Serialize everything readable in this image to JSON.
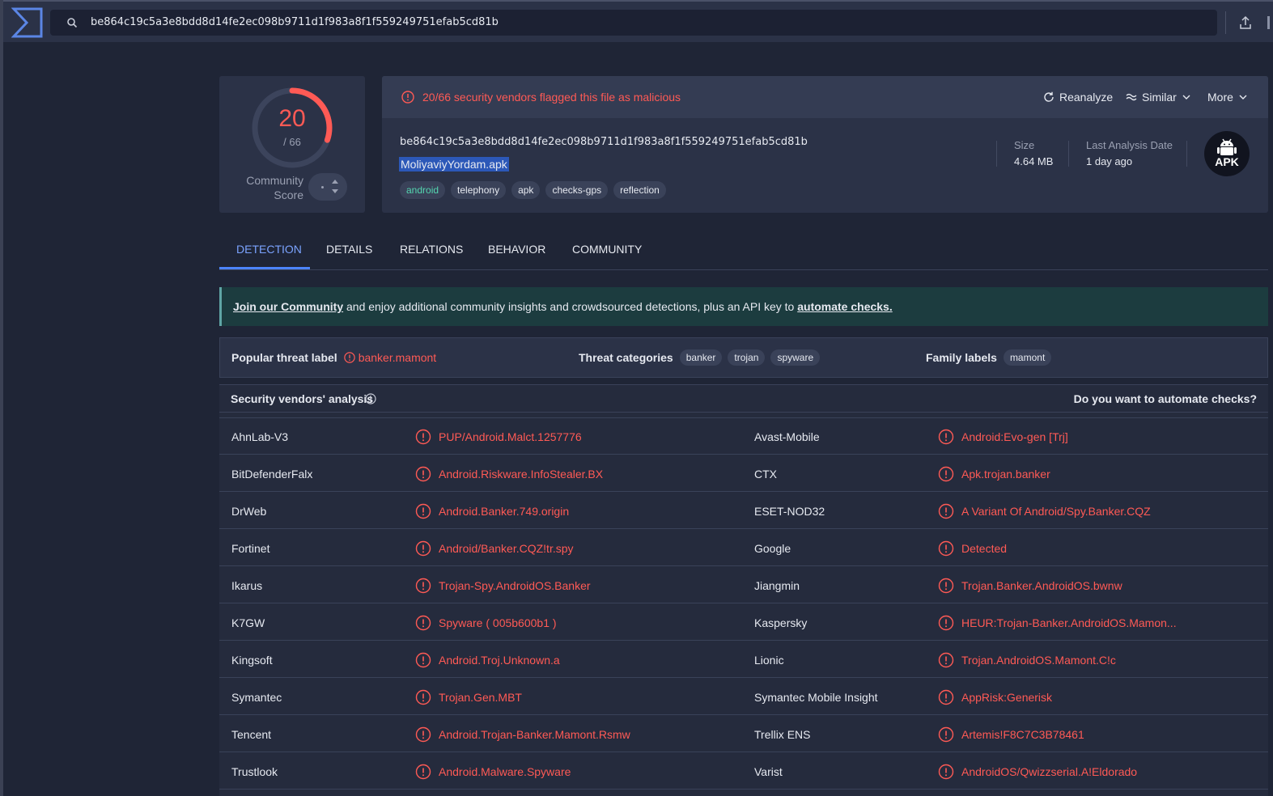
{
  "search": {
    "value": "be864c19c5a3e8bdd8d14fe2ec098b9711d1f983a8f1f559249751efab5cd81b"
  },
  "score": {
    "detections": "20",
    "total": "/ 66",
    "community_label": "Community Score",
    "detected_count": 20,
    "total_count": 66
  },
  "alert": {
    "text": "20/66 security vendors flagged this file as malicious",
    "reanalyze": "Reanalyze",
    "similar": "Similar",
    "more": "More"
  },
  "file": {
    "hash": "be864c19c5a3e8bdd8d14fe2ec098b9711d1f983a8f1f559249751efab5cd81b",
    "name": "MoliyaviyYordam.apk",
    "tags": [
      "android",
      "telephony",
      "apk",
      "checks-gps",
      "reflection"
    ],
    "size_label": "Size",
    "size_value": "4.64 MB",
    "date_label": "Last Analysis Date",
    "date_value": "1 day ago",
    "type_badge": "APK"
  },
  "tabs": [
    "DETECTION",
    "DETAILS",
    "RELATIONS",
    "BEHAVIOR",
    "COMMUNITY"
  ],
  "banner": {
    "link1": "Join our Community",
    "middle": " and enjoy additional community insights and crowdsourced detections, plus an API key to ",
    "link2": "automate checks."
  },
  "threat": {
    "popular_label": "Popular threat label",
    "popular_value": "banker.mamont",
    "categories_label": "Threat categories",
    "categories": [
      "banker",
      "trojan",
      "spyware"
    ],
    "family_label": "Family labels",
    "family": [
      "mamont"
    ]
  },
  "vendors": {
    "title": "Security vendors' analysis",
    "automate": "Do you want to automate checks?",
    "rows": [
      [
        {
          "name": "AhnLab-V3",
          "result": "PUP/Android.Malct.1257776"
        },
        {
          "name": "Avast-Mobile",
          "result": "Android:Evo-gen [Trj]"
        }
      ],
      [
        {
          "name": "BitDefenderFalx",
          "result": "Android.Riskware.InfoStealer.BX"
        },
        {
          "name": "CTX",
          "result": "Apk.trojan.banker"
        }
      ],
      [
        {
          "name": "DrWeb",
          "result": "Android.Banker.749.origin"
        },
        {
          "name": "ESET-NOD32",
          "result": "A Variant Of Android/Spy.Banker.CQZ"
        }
      ],
      [
        {
          "name": "Fortinet",
          "result": "Android/Banker.CQZ!tr.spy"
        },
        {
          "name": "Google",
          "result": "Detected"
        }
      ],
      [
        {
          "name": "Ikarus",
          "result": "Trojan-Spy.AndroidOS.Banker"
        },
        {
          "name": "Jiangmin",
          "result": "Trojan.Banker.AndroidOS.bwnw"
        }
      ],
      [
        {
          "name": "K7GW",
          "result": "Spyware ( 005b600b1 )"
        },
        {
          "name": "Kaspersky",
          "result": "HEUR:Trojan-Banker.AndroidOS.Mamon..."
        }
      ],
      [
        {
          "name": "Kingsoft",
          "result": "Android.Troj.Unknown.a"
        },
        {
          "name": "Lionic",
          "result": "Trojan.AndroidOS.Mamont.C!c"
        }
      ],
      [
        {
          "name": "Symantec",
          "result": "Trojan.Gen.MBT"
        },
        {
          "name": "Symantec Mobile Insight",
          "result": "AppRisk:Generisk"
        }
      ],
      [
        {
          "name": "Tencent",
          "result": "Android.Trojan-Banker.Mamont.Rsmw"
        },
        {
          "name": "Trellix ENS",
          "result": "Artemis!F8C7C3B78461"
        }
      ],
      [
        {
          "name": "Trustlook",
          "result": "Android.Malware.Spyware"
        },
        {
          "name": "Varist",
          "result": "AndroidOS/Qwizzserial.A!Eldorado"
        }
      ]
    ]
  },
  "colors": {
    "malicious": "#ff5a55",
    "accent": "#4c84ff",
    "background": "#1f2536",
    "panel": "#2b3247"
  }
}
